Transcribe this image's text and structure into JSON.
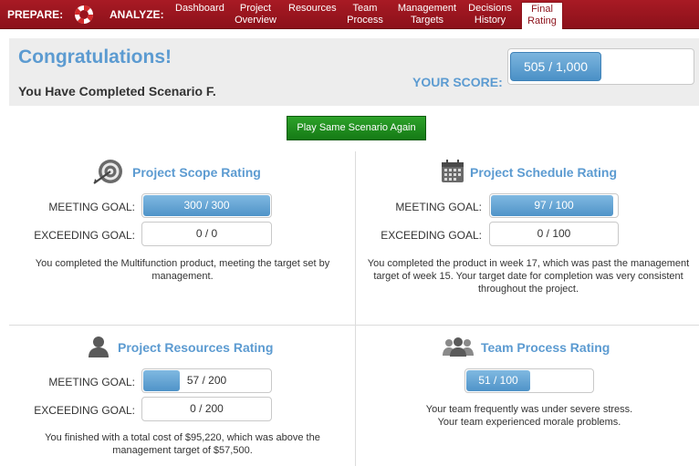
{
  "nav": {
    "prepare_label": "PREPARE:",
    "analyze_label": "ANALYZE:",
    "items": [
      {
        "line1": "Dashboard",
        "line2": ""
      },
      {
        "line1": "Project",
        "line2": "Overview"
      },
      {
        "line1": "Resources",
        "line2": ""
      },
      {
        "line1": "Team",
        "line2": "Process"
      },
      {
        "line1": "Management",
        "line2": "Targets"
      },
      {
        "line1": "Decisions",
        "line2": "History"
      },
      {
        "line1": "Final",
        "line2": "Rating"
      }
    ]
  },
  "congrats": {
    "title": "Congratulations!",
    "subtitle": "You Have Completed Scenario F.",
    "score_label": "YOUR SCORE:",
    "score_text": "505 / 1,000",
    "score_fraction": 0.505
  },
  "play_again_label": "Play Same Scenario Again",
  "scope": {
    "title": "Project Scope Rating",
    "meeting_label": "MEETING GOAL:",
    "meeting_text": "300 / 300",
    "meeting_fraction": 1.0,
    "exceeding_label": "EXCEEDING GOAL:",
    "exceeding_text": "0 / 0",
    "exceeding_fraction": 0,
    "description": "You completed the Multifunction product, meeting the target set by management."
  },
  "schedule": {
    "title": "Project Schedule Rating",
    "meeting_label": "MEETING GOAL:",
    "meeting_text": "97 / 100",
    "meeting_fraction": 0.97,
    "exceeding_label": "EXCEEDING GOAL:",
    "exceeding_text": "0 / 100",
    "exceeding_fraction": 0,
    "description": "You completed the product in week 17, which was past the management target of week 15. Your target date for completion was very consistent throughout the project."
  },
  "resources": {
    "title": "Project Resources Rating",
    "meeting_label": "MEETING GOAL:",
    "meeting_text": "57 / 200",
    "meeting_fraction": 0.285,
    "exceeding_label": "EXCEEDING GOAL:",
    "exceeding_text": "0 / 200",
    "exceeding_fraction": 0,
    "description": "You finished with a total cost of $95,220, which was above the management target of $57,500."
  },
  "team": {
    "title": "Team Process Rating",
    "score_text": "51 / 100",
    "score_fraction": 0.51,
    "description_line1": "Your team frequently was under severe stress.",
    "description_line2": "Your team experienced morale problems."
  },
  "colors": {
    "nav_bg": "#a81a24",
    "accent_blue": "#5c9bd1",
    "bar_fill": "#4f93c8",
    "button_green": "#1e8c1e"
  }
}
